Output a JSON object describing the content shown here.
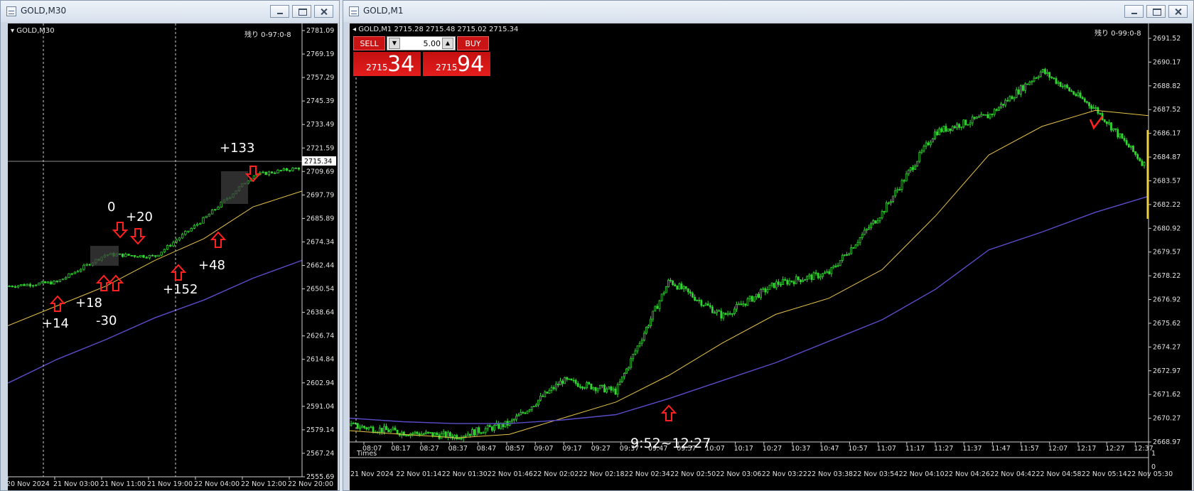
{
  "left_window": {
    "title": "GOLD,M30",
    "symbol_label": "GOLD,M30",
    "countdown": "残り 0-97:0-8",
    "current_price": "2715.34",
    "price_ticks": [
      "2781.09",
      "2769.19",
      "2757.29",
      "2745.39",
      "2733.49",
      "2721.59",
      "2709.69",
      "2697.79",
      "2685.89",
      "2674.34",
      "2662.44",
      "2650.54",
      "2638.64",
      "2626.74",
      "2614.84",
      "2602.94",
      "2591.04",
      "2579.14",
      "2567.24",
      "2555.69"
    ],
    "time_ticks": [
      "20 Nov 2024",
      "21 Nov 03:00",
      "21 Nov 11:00",
      "21 Nov 19:00",
      "22 Nov 04:00",
      "22 Nov 12:00",
      "22 Nov 20:00"
    ],
    "annotations": [
      "+14",
      "+18",
      "-30",
      "0",
      "+20",
      "+152",
      "+48",
      "+133"
    ]
  },
  "right_window": {
    "title": "GOLD,M1",
    "ohlc_label": "GOLD,M1  2715.28 2715.48 2715.02 2715.34",
    "countdown": "残り 0-99:0-8",
    "sell_label": "SELL",
    "buy_label": "BUY",
    "lot_value": "5.00",
    "sell_price_small": "2715",
    "sell_price_big": "34",
    "buy_price_small": "2715",
    "buy_price_big": "94",
    "session_label": "9:52~12:27",
    "times_label": "Times",
    "price_ticks": [
      "2691.52",
      "2690.17",
      "2688.82",
      "2687.52",
      "2686.17",
      "2684.87",
      "2683.57",
      "2682.22",
      "2680.92",
      "2679.57",
      "2678.22",
      "2676.92",
      "2675.62",
      "2674.27",
      "2672.97",
      "2671.62",
      "2670.27",
      "2668.97"
    ],
    "time_axis_top": [
      "08:07",
      "08:17",
      "08:27",
      "08:37",
      "08:47",
      "08:57",
      "09:07",
      "09:17",
      "09:27",
      "09:37",
      "09:47",
      "09:57",
      "10:07",
      "10:17",
      "10:27",
      "10:37",
      "10:47",
      "10:57",
      "11:07",
      "11:17",
      "11:27",
      "11:37",
      "11:47",
      "11:57",
      "12:07",
      "12:17",
      "12:27",
      "12:37"
    ],
    "time_axis_bottom": [
      "21 Nov 2024",
      "22 Nov 01:14",
      "22 Nov 01:30",
      "22 Nov 01:46",
      "22 Nov 02:02",
      "22 Nov 02:18",
      "22 Nov 02:34",
      "22 Nov 02:50",
      "22 Nov 03:06",
      "22 Nov 03:22",
      "22 Nov 03:38",
      "22 Nov 03:54",
      "22 Nov 04:10",
      "22 Nov 04:26",
      "22 Nov 04:42",
      "22 Nov 04:58",
      "22 Nov 05:14",
      "22 Nov 05:30"
    ],
    "subwindow_ticks": [
      "1",
      "0"
    ]
  },
  "colors": {
    "bull": "#2fd62f",
    "ma_fast": "#e6c34a",
    "ma_slow": "#5a4cc8",
    "arrow": "#ff2020",
    "annotation_text": "#ffffff"
  },
  "chart_data": [
    {
      "type": "line",
      "title": "GOLD,M30",
      "ylim": [
        2555.69,
        2781.09
      ],
      "x": [
        "20 Nov 2024",
        "21 Nov 03:00",
        "21 Nov 11:00",
        "21 Nov 19:00",
        "22 Nov 04:00",
        "22 Nov 12:00",
        "22 Nov 20:00"
      ],
      "series": [
        {
          "values": [
            2652,
            2654,
            2668,
            2667,
            2686,
            2708,
            2712
          ]
        },
        {
          "values": [
            2632,
            2642,
            2652,
            2665,
            2676,
            2692,
            2700
          ]
        },
        {
          "values": [
            2603,
            2615,
            2625,
            2636,
            2645,
            2656,
            2665
          ]
        }
      ]
    },
    {
      "type": "line",
      "title": "GOLD,M1",
      "ylim": [
        2668.97,
        2691.52
      ],
      "x": [
        "08:07",
        "08:27",
        "08:47",
        "09:07",
        "09:27",
        "09:47",
        "10:07",
        "10:27",
        "10:47",
        "11:07",
        "11:27",
        "11:47",
        "12:07",
        "12:17",
        "12:27",
        "12:37"
      ],
      "series": [
        {
          "values": [
            2669.9,
            2669.5,
            2669.3,
            2670.0,
            2672.4,
            2671.8,
            2678.0,
            2676.0,
            2677.8,
            2678.4,
            2681.8,
            2686.3,
            2687.2,
            2689.7,
            2687.6,
            2684.2
          ]
        },
        {
          "values": [
            2669.6,
            2669.4,
            2669.2,
            2669.4,
            2670.3,
            2671.2,
            2672.7,
            2674.5,
            2676.1,
            2677.0,
            2678.6,
            2681.6,
            2685.0,
            2686.6,
            2687.5,
            2687.2
          ]
        },
        {
          "values": [
            2670.3,
            2670.1,
            2670.0,
            2670.0,
            2670.2,
            2670.5,
            2671.4,
            2672.4,
            2673.4,
            2674.6,
            2675.8,
            2677.5,
            2679.7,
            2680.7,
            2681.8,
            2682.7
          ]
        }
      ]
    }
  ]
}
